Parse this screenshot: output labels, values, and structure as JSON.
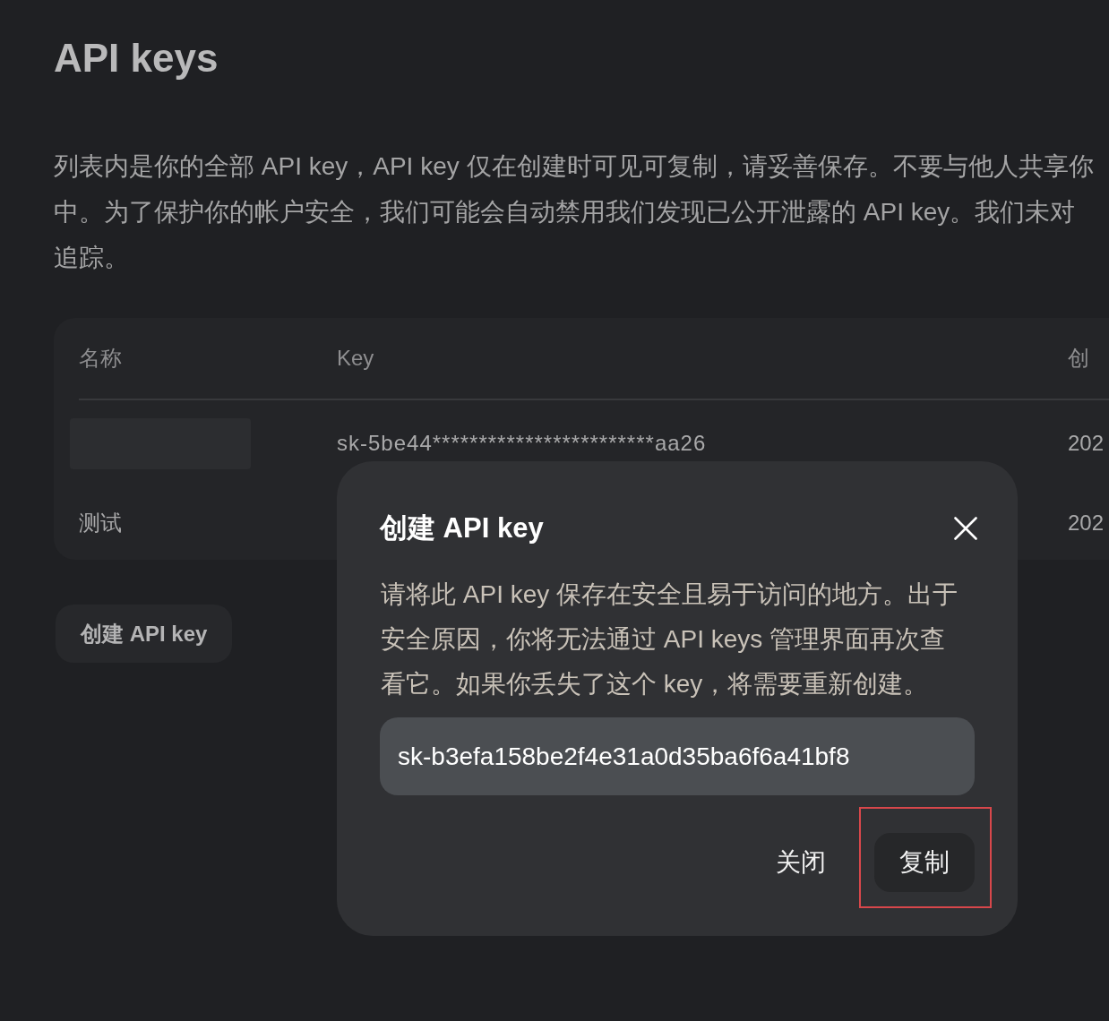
{
  "background_page": {
    "title": "API keys",
    "description_lines": [
      "列表内是你的全部 API key，API key 仅在创建时可见可复制，请妥善保存。不要与他人共享你",
      "中。为了保护你的帐户安全，我们可能会自动禁用我们发现已公开泄露的 API key。我们未对",
      "追踪。"
    ],
    "table": {
      "columns": [
        {
          "label": "名称"
        },
        {
          "label": "Key"
        },
        {
          "label": "创"
        }
      ],
      "rows": [
        {
          "kind": "redacted",
          "key": "sk-5be44************************aa26",
          "column_3": "202"
        },
        {
          "kind": "named",
          "name": "测试",
          "column_3": "202"
        }
      ]
    },
    "create_button": "创建 API key"
  },
  "dialog": {
    "title": "创建 API key",
    "message": "请将此 API key 保存在安全且易于访问的地方。出于安全原因，你将无法通过 API keys 管理界面再次查看它。如果你丢失了这个 key，将需要重新创建。",
    "key_field": {
      "value": "sk-b3efa158be2f4e31a0d35ba6f6a41bf8"
    },
    "actions": [
      {
        "label": "关闭",
        "kind": "text",
        "highlighted": false
      },
      {
        "label": "复制",
        "kind": "filled",
        "highlighted": true
      }
    ]
  }
}
